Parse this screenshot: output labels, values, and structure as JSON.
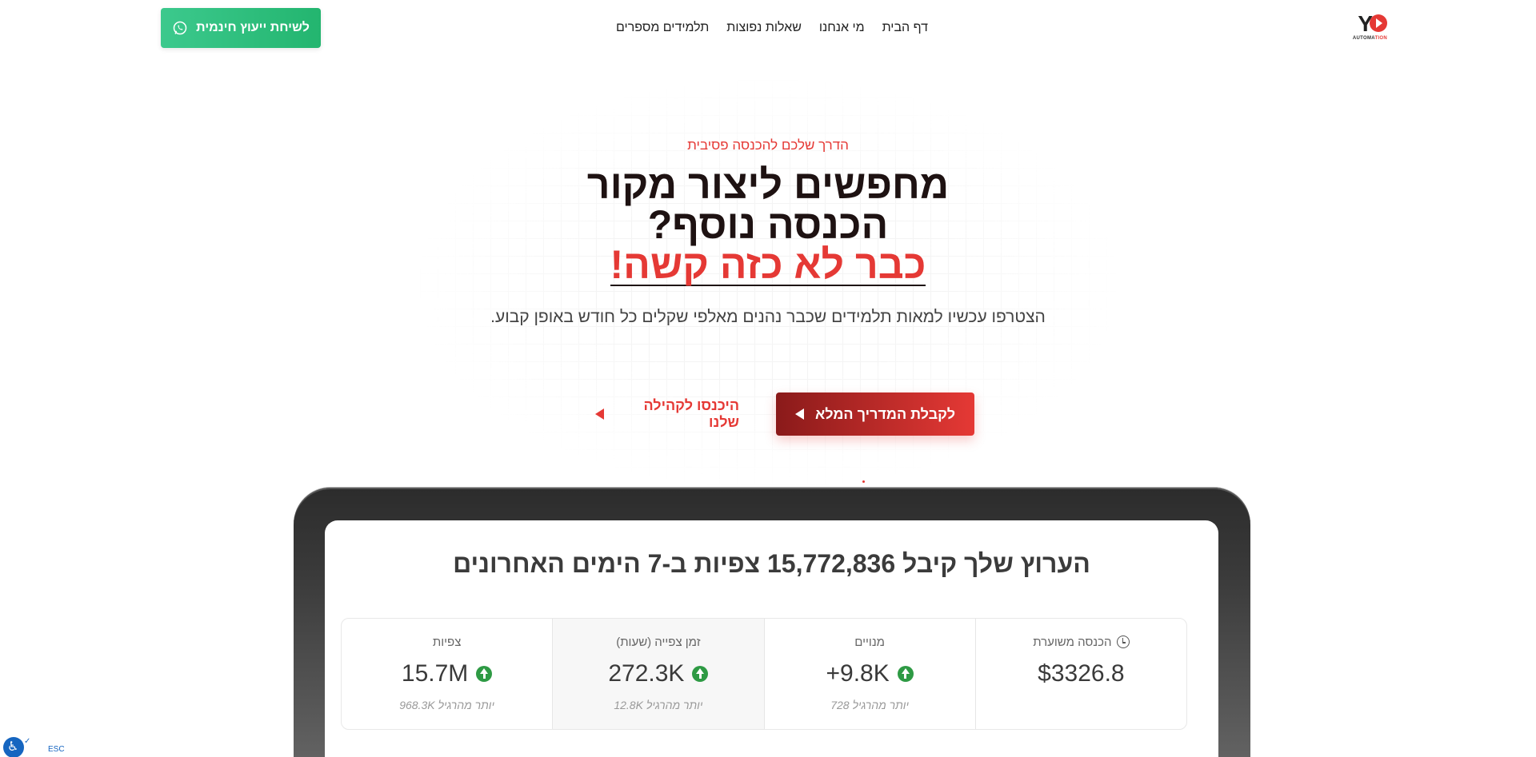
{
  "header": {
    "logo_text": "YO",
    "logo_sub_a": "AUTOMA",
    "logo_sub_b": "TION",
    "nav": [
      "דף הבית",
      "מי אנחנו",
      "שאלות נפוצות",
      "תלמידים מספרים"
    ],
    "cta_label": "לשיחת ייעוץ חינמית",
    "cta_icon": "whatsapp-icon"
  },
  "hero": {
    "eyebrow": "הדרך שלכם להכנסה פסיבית",
    "title_line1": "מחפשים ליצור מקור",
    "title_line2": "הכנסה נוסף?",
    "title_accent": "כבר לא כזה קשה!",
    "lead": "הצטרפו עכשיו למאות תלמידים שכבר נהנים מאלפי שקלים כל חודש באופן קבוע.",
    "primary_cta": "לקבלת המדריך המלא",
    "secondary_cta": "היכנסו לקהילה שלנו"
  },
  "dashboard": {
    "title": "הערוץ שלך קיבל 15,772,836 צפיות ב-7 הימים האחרונים",
    "stats": [
      {
        "label": "הכנסה משוערת",
        "value": "$3326.8",
        "sub": "",
        "icon": "clock-icon",
        "up": false
      },
      {
        "label": "מנויים",
        "value": "+9.8K",
        "sub": "יותר מהרגיל 728",
        "up": true
      },
      {
        "label": "זמן צפייה (שעות)",
        "value": "272.3K",
        "sub": "יותר מהרגיל 12.8K",
        "up": true
      },
      {
        "label": "צפיות",
        "value": "15.7M",
        "sub": "יותר מהרגיל 968.3K",
        "up": true
      }
    ]
  },
  "accessibility": {
    "icon": "accessibility-icon",
    "esc_label": "ESC"
  },
  "colors": {
    "accent": "#e53935",
    "whatsapp": "#25b76f",
    "dark": "#1e1212"
  }
}
